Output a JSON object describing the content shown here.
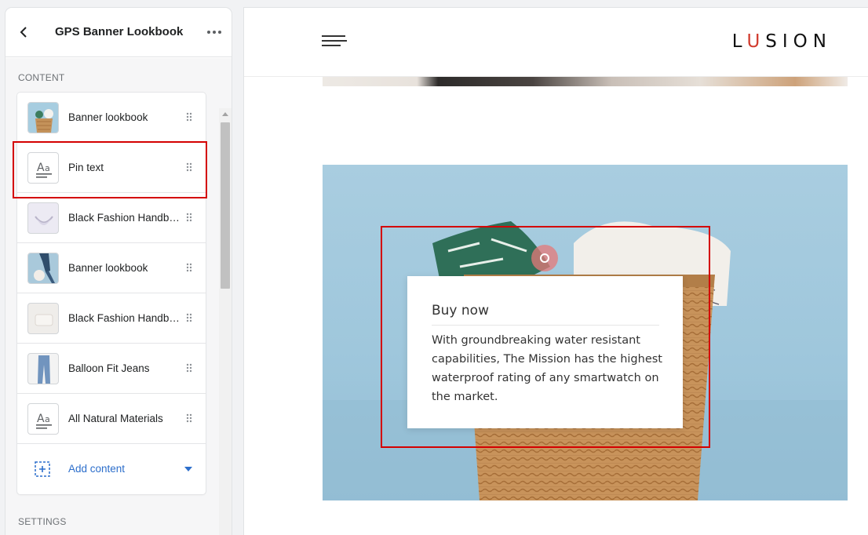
{
  "sidebar": {
    "title": "GPS Banner Lookbook",
    "content_label": "CONTENT",
    "settings_label": "SETTINGS",
    "blocks": [
      {
        "label": "Banner lookbook",
        "icon": "basket-image-thumbnail"
      },
      {
        "label": "Pin text",
        "icon": "text-format-icon"
      },
      {
        "label": "Black Fashion Handbag",
        "icon": "handbag-image-thumbnail"
      },
      {
        "label": "Banner lookbook",
        "icon": "person-image-thumbnail"
      },
      {
        "label": "Black Fashion Handbag",
        "icon": "handbag-image-thumbnail"
      },
      {
        "label": "Balloon Fit Jeans",
        "icon": "jeans-image-thumbnail"
      },
      {
        "label": "All Natural Materials",
        "icon": "text-format-icon"
      }
    ],
    "add_content_label": "Add content",
    "accent_color": "#2c6ecb",
    "highlight_color": "#d40000"
  },
  "preview": {
    "logo": {
      "before": "L",
      "accent": "U",
      "after": "SION"
    },
    "logo_accent_color": "#d13b2e",
    "pin": {
      "title": "Buy now",
      "text": "With groundbreaking water resistant capabilities, The Mission has the highest waterproof rating of any smartwatch on the market."
    },
    "banner_bg_color": "#a9cde0"
  }
}
